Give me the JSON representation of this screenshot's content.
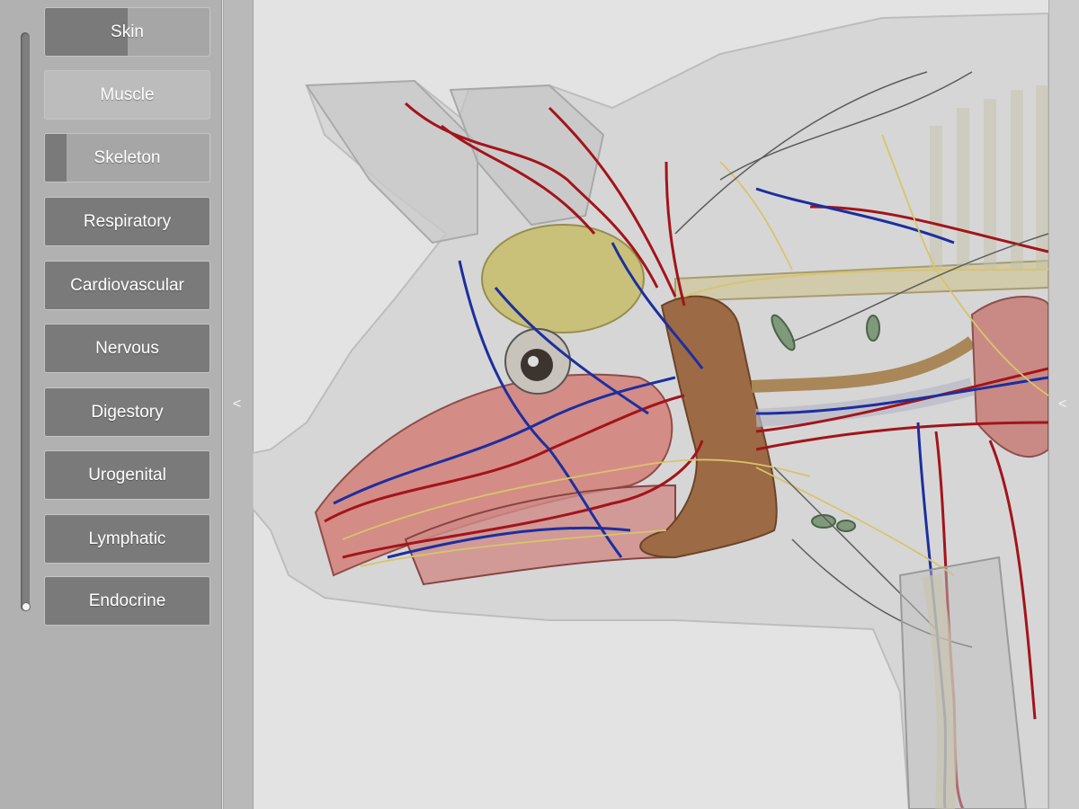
{
  "sidebar": {
    "layers": [
      {
        "label": "Skin",
        "level": 0.5
      },
      {
        "label": "Muscle",
        "level": 0.0
      },
      {
        "label": "Skeleton",
        "level": 0.13
      },
      {
        "label": "Respiratory",
        "level": 1.0
      },
      {
        "label": "Cardiovascular",
        "level": 1.0
      },
      {
        "label": "Nervous",
        "level": 1.0
      },
      {
        "label": "Digestory",
        "level": 1.0
      },
      {
        "label": "Urogenital",
        "level": 1.0
      },
      {
        "label": "Lymphatic",
        "level": 1.0
      },
      {
        "label": "Endocrine",
        "level": 1.0
      }
    ]
  },
  "handles": {
    "left_arrow": "<",
    "right_arrow": "<"
  },
  "viewport": {
    "subject": "pig-anatomy-3d-model",
    "colors": {
      "arteries": "#a3141a",
      "veins": "#1c2f9e",
      "nerves": "#d8c46a",
      "brain": "#c9c07a",
      "tongue": "#d48c86",
      "gland": "#9c6a45",
      "skin": "#d6d6d6"
    }
  }
}
